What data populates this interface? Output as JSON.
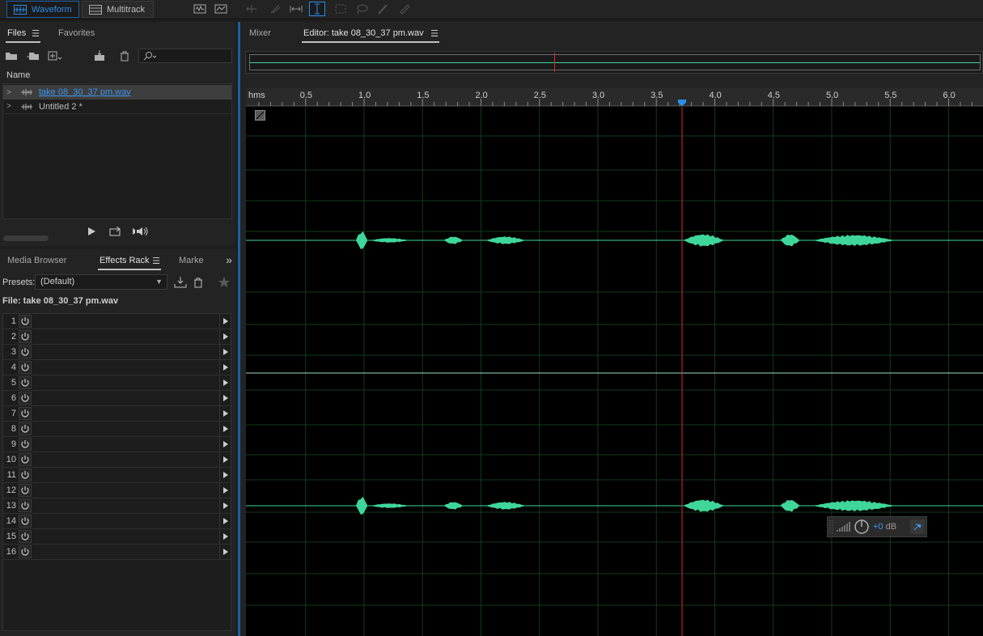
{
  "toolbar": {
    "waveform_label": "Waveform",
    "multitrack_label": "Multitrack"
  },
  "files_panel": {
    "tab_files": "Files",
    "tab_favorites": "Favorites",
    "column_name": "Name",
    "files": [
      {
        "name": "take 08_30_37 pm.wav",
        "selected": true
      },
      {
        "name": "Untitled 2 *",
        "selected": false
      }
    ]
  },
  "effects_panel": {
    "tab_media_browser": "Media Browser",
    "tab_effects_rack": "Effects Rack",
    "tab_markers": "Marke",
    "presets_label": "Presets:",
    "presets_value": "(Default)",
    "file_label": "File: take 08_30_37 pm.wav",
    "rack_slots": [
      "1",
      "2",
      "3",
      "4",
      "5",
      "6",
      "7",
      "8",
      "9",
      "10",
      "11",
      "12",
      "13",
      "14",
      "15",
      "16"
    ]
  },
  "editor": {
    "tab_mixer": "Mixer",
    "tab_editor": "Editor: take 08_30_37 pm.wav",
    "ruler_unit": "hms",
    "ruler_ticks": [
      "0.5",
      "1.0",
      "1.5",
      "2.0",
      "2.5",
      "3.0",
      "3.5",
      "4.0",
      "4.5",
      "5.0",
      "5.5",
      "6.0"
    ],
    "playhead_seconds": 3.72,
    "visible_start_seconds": 0.0,
    "visible_end_seconds": 6.3,
    "hud_gain_value": "+0",
    "hud_gain_unit": " dB"
  },
  "colors": {
    "accent": "#2d8ceb",
    "waveform": "#3fd69a",
    "playhead": "#d92b2b",
    "grid": "#133a1c"
  },
  "icons": [
    "open-folder-icon",
    "import-icon",
    "new-file-icon",
    "insert-icon",
    "trash-icon",
    "search-icon",
    "play-icon",
    "loop-icon",
    "autoplay-icon",
    "power-icon",
    "arrow-right-icon",
    "download-icon",
    "star-icon",
    "pin-icon",
    "knob-icon",
    "meter-icon",
    "waveform-file-icon"
  ]
}
